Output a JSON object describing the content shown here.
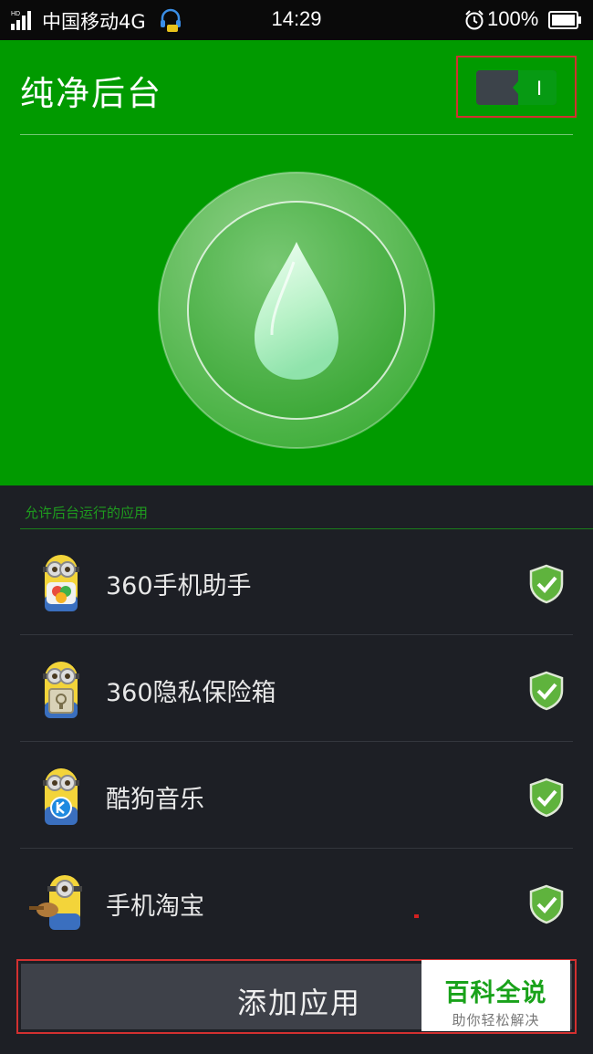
{
  "status_bar": {
    "network_badge": "HD",
    "carrier": "中国移动4G",
    "time": "14:29",
    "battery": "100%",
    "icons": [
      "signal-icon",
      "headset-icon",
      "alarm-icon",
      "battery-icon"
    ]
  },
  "header": {
    "title": "纯净后台",
    "toggle_label": "I",
    "toggle_state": "on"
  },
  "section": {
    "label": "允许后台运行的应用"
  },
  "apps": [
    {
      "name": "360手机助手",
      "icon": "minion-avatar-icon",
      "status_icon": "shield-check-icon"
    },
    {
      "name": "360隐私保险箱",
      "icon": "minion-avatar-icon",
      "status_icon": "shield-check-icon"
    },
    {
      "name": "酷狗音乐",
      "icon": "minion-avatar-icon",
      "status_icon": "shield-check-icon"
    },
    {
      "name": "手机淘宝",
      "icon": "minion-avatar-icon",
      "status_icon": "shield-check-icon"
    }
  ],
  "footer": {
    "add_button": "添加应用"
  },
  "watermark": {
    "title": "百科全说",
    "subtitle": "助你轻松解决"
  },
  "colors": {
    "hero_green": "#019a00",
    "list_bg": "#1d1f25",
    "accent_green": "#1e9c1e",
    "highlight_red": "#d23030"
  }
}
